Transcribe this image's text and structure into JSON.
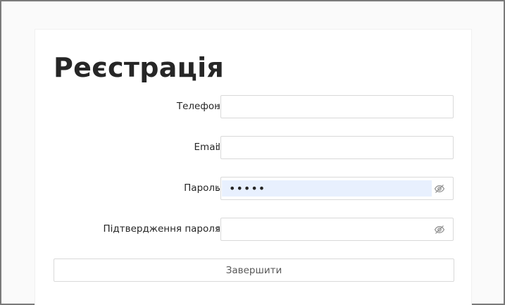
{
  "form": {
    "title": "Реєстрація",
    "colon": ":",
    "fields": {
      "phone": {
        "label": "Телефон",
        "value": "",
        "placeholder": ""
      },
      "email": {
        "label": "Email",
        "value": "",
        "placeholder": ""
      },
      "password": {
        "label": "Пароль",
        "value": "•••••",
        "placeholder": "",
        "visibility_icon": "eye-invisible-icon"
      },
      "confirm_password": {
        "label": "Підтвердження пароля",
        "value": "",
        "placeholder": "",
        "visibility_icon": "eye-invisible-icon"
      }
    },
    "submit_label": "Завершити"
  },
  "colors": {
    "autofill_background": "#e8f0fe",
    "border": "#d9d9d9",
    "frame_border": "#7a7a7a"
  }
}
